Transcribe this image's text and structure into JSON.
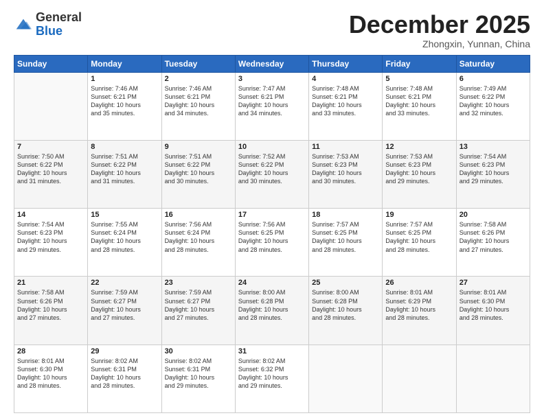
{
  "header": {
    "logo_general": "General",
    "logo_blue": "Blue",
    "month_title": "December 2025",
    "location": "Zhongxin, Yunnan, China"
  },
  "days_of_week": [
    "Sunday",
    "Monday",
    "Tuesday",
    "Wednesday",
    "Thursday",
    "Friday",
    "Saturday"
  ],
  "weeks": [
    [
      {
        "day": "",
        "detail": ""
      },
      {
        "day": "1",
        "detail": "Sunrise: 7:46 AM\nSunset: 6:21 PM\nDaylight: 10 hours\nand 35 minutes."
      },
      {
        "day": "2",
        "detail": "Sunrise: 7:46 AM\nSunset: 6:21 PM\nDaylight: 10 hours\nand 34 minutes."
      },
      {
        "day": "3",
        "detail": "Sunrise: 7:47 AM\nSunset: 6:21 PM\nDaylight: 10 hours\nand 34 minutes."
      },
      {
        "day": "4",
        "detail": "Sunrise: 7:48 AM\nSunset: 6:21 PM\nDaylight: 10 hours\nand 33 minutes."
      },
      {
        "day": "5",
        "detail": "Sunrise: 7:48 AM\nSunset: 6:21 PM\nDaylight: 10 hours\nand 33 minutes."
      },
      {
        "day": "6",
        "detail": "Sunrise: 7:49 AM\nSunset: 6:22 PM\nDaylight: 10 hours\nand 32 minutes."
      }
    ],
    [
      {
        "day": "7",
        "detail": "Sunrise: 7:50 AM\nSunset: 6:22 PM\nDaylight: 10 hours\nand 31 minutes."
      },
      {
        "day": "8",
        "detail": "Sunrise: 7:51 AM\nSunset: 6:22 PM\nDaylight: 10 hours\nand 31 minutes."
      },
      {
        "day": "9",
        "detail": "Sunrise: 7:51 AM\nSunset: 6:22 PM\nDaylight: 10 hours\nand 30 minutes."
      },
      {
        "day": "10",
        "detail": "Sunrise: 7:52 AM\nSunset: 6:22 PM\nDaylight: 10 hours\nand 30 minutes."
      },
      {
        "day": "11",
        "detail": "Sunrise: 7:53 AM\nSunset: 6:23 PM\nDaylight: 10 hours\nand 30 minutes."
      },
      {
        "day": "12",
        "detail": "Sunrise: 7:53 AM\nSunset: 6:23 PM\nDaylight: 10 hours\nand 29 minutes."
      },
      {
        "day": "13",
        "detail": "Sunrise: 7:54 AM\nSunset: 6:23 PM\nDaylight: 10 hours\nand 29 minutes."
      }
    ],
    [
      {
        "day": "14",
        "detail": "Sunrise: 7:54 AM\nSunset: 6:23 PM\nDaylight: 10 hours\nand 29 minutes."
      },
      {
        "day": "15",
        "detail": "Sunrise: 7:55 AM\nSunset: 6:24 PM\nDaylight: 10 hours\nand 28 minutes."
      },
      {
        "day": "16",
        "detail": "Sunrise: 7:56 AM\nSunset: 6:24 PM\nDaylight: 10 hours\nand 28 minutes."
      },
      {
        "day": "17",
        "detail": "Sunrise: 7:56 AM\nSunset: 6:25 PM\nDaylight: 10 hours\nand 28 minutes."
      },
      {
        "day": "18",
        "detail": "Sunrise: 7:57 AM\nSunset: 6:25 PM\nDaylight: 10 hours\nand 28 minutes."
      },
      {
        "day": "19",
        "detail": "Sunrise: 7:57 AM\nSunset: 6:25 PM\nDaylight: 10 hours\nand 28 minutes."
      },
      {
        "day": "20",
        "detail": "Sunrise: 7:58 AM\nSunset: 6:26 PM\nDaylight: 10 hours\nand 27 minutes."
      }
    ],
    [
      {
        "day": "21",
        "detail": "Sunrise: 7:58 AM\nSunset: 6:26 PM\nDaylight: 10 hours\nand 27 minutes."
      },
      {
        "day": "22",
        "detail": "Sunrise: 7:59 AM\nSunset: 6:27 PM\nDaylight: 10 hours\nand 27 minutes."
      },
      {
        "day": "23",
        "detail": "Sunrise: 7:59 AM\nSunset: 6:27 PM\nDaylight: 10 hours\nand 27 minutes."
      },
      {
        "day": "24",
        "detail": "Sunrise: 8:00 AM\nSunset: 6:28 PM\nDaylight: 10 hours\nand 28 minutes."
      },
      {
        "day": "25",
        "detail": "Sunrise: 8:00 AM\nSunset: 6:28 PM\nDaylight: 10 hours\nand 28 minutes."
      },
      {
        "day": "26",
        "detail": "Sunrise: 8:01 AM\nSunset: 6:29 PM\nDaylight: 10 hours\nand 28 minutes."
      },
      {
        "day": "27",
        "detail": "Sunrise: 8:01 AM\nSunset: 6:30 PM\nDaylight: 10 hours\nand 28 minutes."
      }
    ],
    [
      {
        "day": "28",
        "detail": "Sunrise: 8:01 AM\nSunset: 6:30 PM\nDaylight: 10 hours\nand 28 minutes."
      },
      {
        "day": "29",
        "detail": "Sunrise: 8:02 AM\nSunset: 6:31 PM\nDaylight: 10 hours\nand 28 minutes."
      },
      {
        "day": "30",
        "detail": "Sunrise: 8:02 AM\nSunset: 6:31 PM\nDaylight: 10 hours\nand 29 minutes."
      },
      {
        "day": "31",
        "detail": "Sunrise: 8:02 AM\nSunset: 6:32 PM\nDaylight: 10 hours\nand 29 minutes."
      },
      {
        "day": "",
        "detail": ""
      },
      {
        "day": "",
        "detail": ""
      },
      {
        "day": "",
        "detail": ""
      }
    ]
  ]
}
